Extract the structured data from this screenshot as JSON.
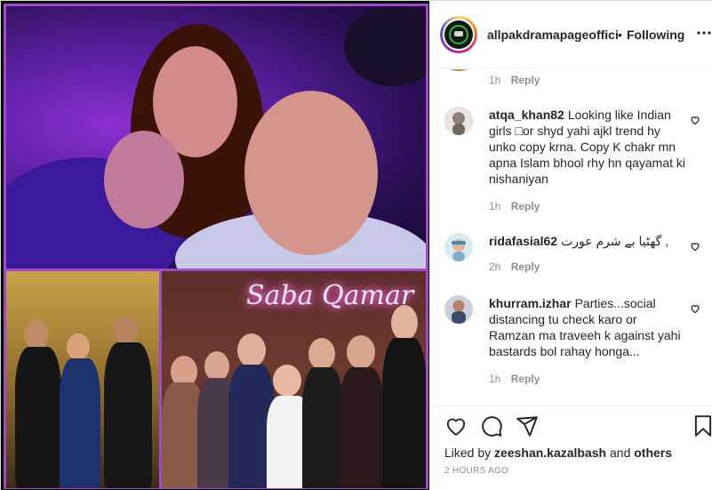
{
  "post": {
    "image_alt": "",
    "neon_sign": "Saba Qamar"
  },
  "header": {
    "username": "allpakdramapageoffici",
    "separator": "•",
    "follow_status": "Following",
    "more_icon": "more-horizontal-icon"
  },
  "previous_comment": {
    "time": "1h",
    "reply_label": "Reply"
  },
  "comments": [
    {
      "username": "atqa_khan82",
      "text": "Looking like Indian girls □or shyd yahi ajkl trend hy unko copy krna. Copy K chakr mn apna Islam bhool rhy hn qayamat ki nishaniyan",
      "time": "1h",
      "reply_label": "Reply",
      "avatar_color": "#9a8f8a"
    },
    {
      "username": "ridafasial62",
      "text": "گھٹیا بے شرم عورت ,",
      "time": "2h",
      "reply_label": "Reply",
      "avatar_color": "#7fb0c9"
    },
    {
      "username": "khurram.izhar",
      "text": "Parties...social distancing tu check karo or Ramzan ma traveeh k against yahi bastards bol rahay honga...",
      "time": "1h",
      "reply_label": "Reply",
      "avatar_color": "#3a4d6a"
    }
  ],
  "actions": {
    "like_icon": "heart-icon",
    "comment_icon": "comment-icon",
    "share_icon": "paper-plane-icon",
    "save_icon": "bookmark-icon"
  },
  "likes": {
    "prefix": "Liked by",
    "user": "zeeshan.kazalbash",
    "conjunction": "and",
    "others": "others"
  },
  "timestamp": "2 HOURS AGO",
  "colors": {
    "text": "#262626",
    "muted": "#8e8e8e",
    "border": "#dbdbdb",
    "collage_border": "#a04ac8"
  }
}
